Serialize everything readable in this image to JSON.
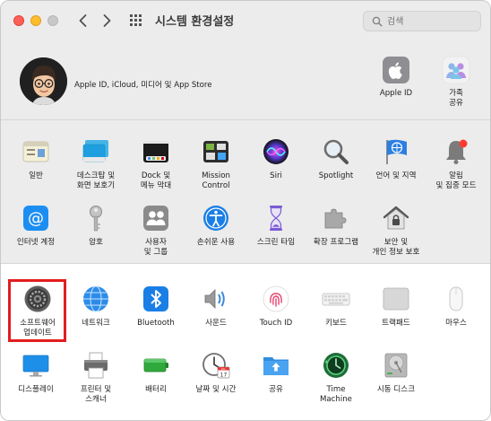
{
  "window": {
    "title": "시스템 환경설정"
  },
  "search": {
    "placeholder": "검색"
  },
  "account": {
    "text": "Apple ID, iCloud, 미디어 및 App Store",
    "apple_id": "Apple ID",
    "family": "가족\n공유"
  },
  "row1": [
    "일반",
    "데스크탑 및\n화면 보호기",
    "Dock 및\n메뉴 막대",
    "Mission\nControl",
    "Siri",
    "Spotlight",
    "언어 및 지역",
    "알림\n및 집중 모드"
  ],
  "row2": [
    "인터넷 계정",
    "암호",
    "사용자\n및 그룹",
    "손쉬운 사용",
    "스크린 타임",
    "확장 프로그램",
    "보안 및\n개인 정보 보호"
  ],
  "row3": [
    "소프트웨어\n업데이트",
    "네트워크",
    "Bluetooth",
    "사운드",
    "Touch ID",
    "키보드",
    "트랙패드",
    "마우스"
  ],
  "row4": [
    "디스플레이",
    "프린터 및\n스캐너",
    "배터리",
    "날짜 및 시간",
    "공유",
    "Time\nMachine",
    "시동 디스크"
  ],
  "calendar_day": "17",
  "calendar_month": "JUL",
  "highlight_color": "#e21d20",
  "selected_pane": "소프트웨어 업데이트"
}
